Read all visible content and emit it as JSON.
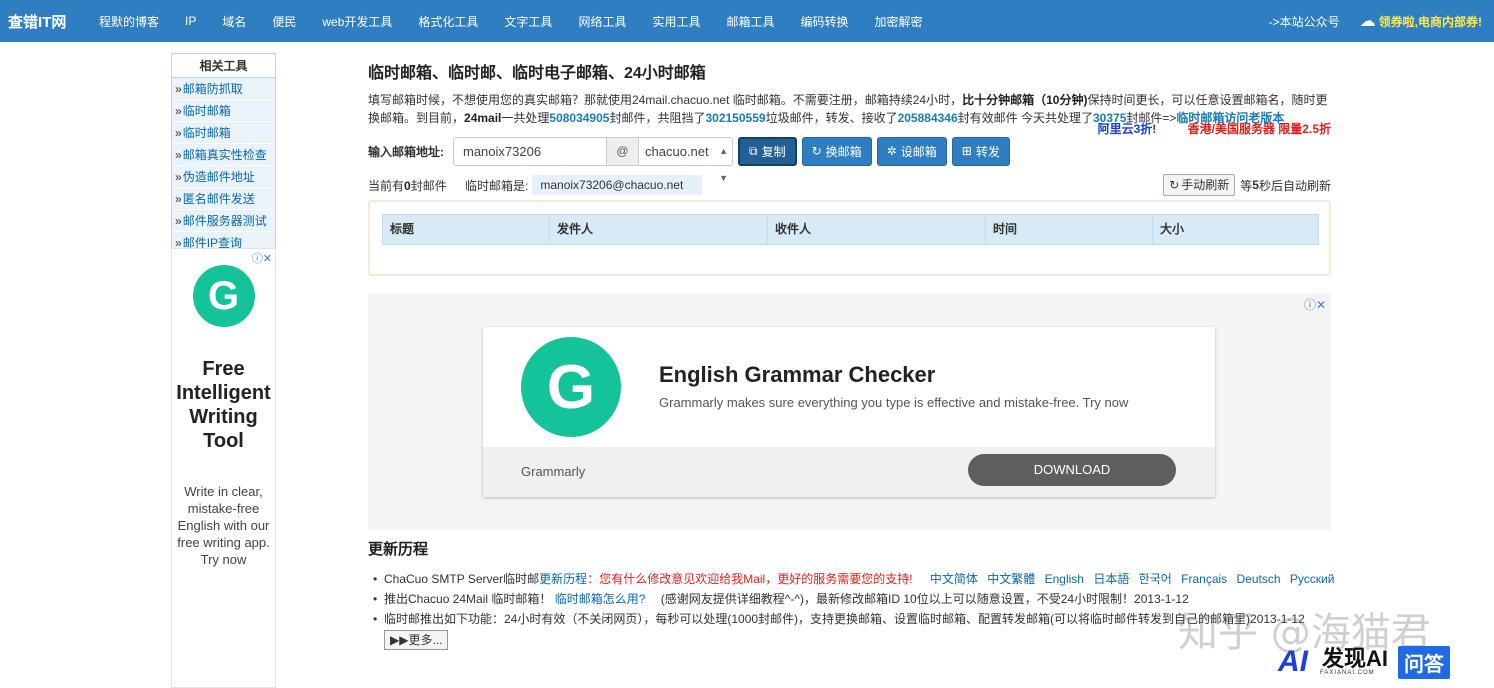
{
  "nav": {
    "brand": "查错IT网",
    "items": [
      "程默的博客",
      "IP",
      "域名",
      "便民",
      "web开发工具",
      "格式化工具",
      "文字工具",
      "网络工具",
      "实用工具",
      "邮箱工具",
      "编码转换",
      "加密解密"
    ],
    "account_link": "->本站公众号",
    "promo": "领券啦,电商内部券!"
  },
  "sidebar": {
    "heading": "相关工具",
    "items": [
      "邮箱防抓取",
      "临时邮箱",
      "临时邮箱",
      "邮箱真实性检查",
      "伪造邮件地址",
      "匿名邮件发送",
      "邮件服务器测试",
      "邮件IP查询"
    ]
  },
  "side_ad": {
    "title_lines": [
      "Free",
      "Intelligent",
      "Writing",
      "Tool"
    ],
    "desc": "Write in clear, mistake-free English with our free writing app. Try now"
  },
  "main": {
    "title": "临时邮箱、临时邮、临时电子邮箱、24小时邮箱",
    "intro": {
      "t1": "填写邮箱时候，不想使用您的真实邮箱？那就使用24mail.chacuo.net 临时邮箱。不需要注册，邮箱持续24小时，",
      "b1": "比十分钟邮箱（10分钟)",
      "t2": "保持时间更长，可以任意设置邮箱名，随时更换邮箱。到目前，",
      "b2": "24mail",
      "t3": "一共处理",
      "n1": "508034905",
      "t4": "封邮件，共阻挡了",
      "n2": "302150559",
      "t5": "垃圾邮件，转发、接收了",
      "n3": "205884346",
      "t6": "封有效邮件 今天共处理了",
      "n4": "30375",
      "t7": "封邮件=>",
      "link": "临时邮箱访问老版本"
    },
    "promo1": "阿里云3折!",
    "promo2": "香港/美国服务器 限量2.5折",
    "input_label": "输入邮箱地址:",
    "email_value": "manoix73206",
    "at": "@",
    "domain": "chacuo.net",
    "buttons": {
      "copy": "复制",
      "change": "换邮箱",
      "set": "设邮箱",
      "forward": "转发"
    },
    "count_prefix": "当前有",
    "count": "0",
    "count_suffix": "封邮件",
    "tmp_label": "临时邮箱是:",
    "tmp_address": "manoix73206@chacuo.net",
    "refresh_button": "手动刷新",
    "refresh_prefix": "等",
    "refresh_seconds": "5",
    "refresh_suffix": "秒后自动刷新",
    "table_headers": [
      "标题",
      "发件人",
      "收件人",
      "时间",
      "大小"
    ]
  },
  "big_ad": {
    "headline": "English Grammar Checker",
    "subtitle": "Grammarly makes sure everything you type is effective and mistake-free. Try now",
    "brand": "Grammarly",
    "cta": "DOWNLOAD"
  },
  "history": {
    "title": "更新历程",
    "item1_text": "ChaCuo SMTP Server临时邮",
    "item1_link": "更新历程",
    "item1_colon": "：",
    "item1_red": "您有什么修改意见欢迎给我Mail，更好的服务需要您的支持!",
    "languages": [
      "中文简体",
      "中文繁體",
      "English",
      "日本語",
      "한국어",
      "Français",
      "Deutsch",
      "Русский"
    ],
    "item2_text": "推出Chacuo 24Mail 临时邮箱！",
    "item2_link": "临时邮箱怎么用?",
    "item2_rest": "(感谢网友提供详细教程^-^)，最新修改邮箱ID 10位以上可以随意设置，不受24小时限制！2013-1-12",
    "item3_text": "临时邮推出如下功能：24小时有效（不关闭网页），每秒可以处理(1000封邮件)，支持更换邮箱、设置临时邮箱、配置转发邮箱(可以将临时邮件转发到自己的邮箱里)2013-1-12",
    "more": "更多..."
  },
  "watermark": {
    "text": "知乎 @海猫君",
    "badge": "发现AI",
    "badge_sub": "FAXIANAI.COM",
    "qa": "问答"
  }
}
